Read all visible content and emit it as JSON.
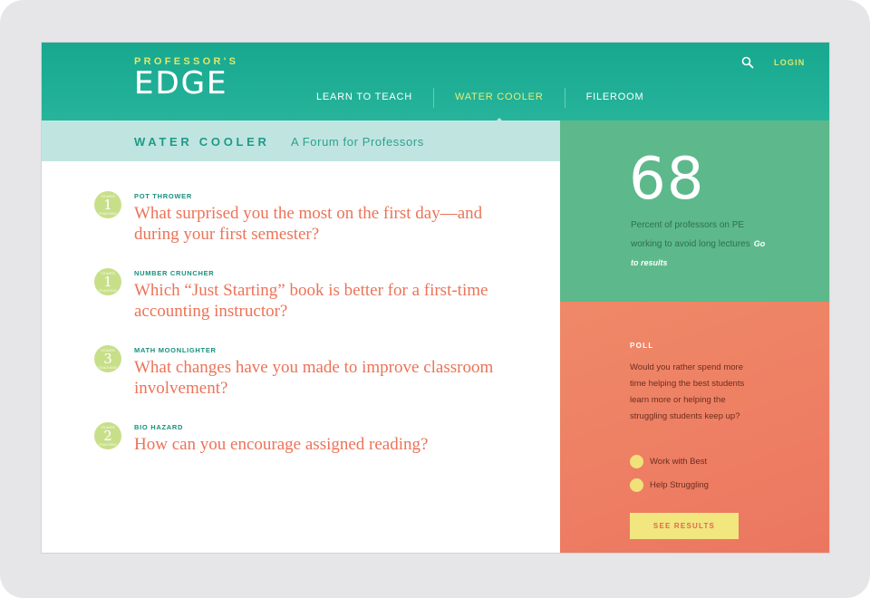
{
  "logo": {
    "top": "PROFESSOR'S",
    "main": "EDGE"
  },
  "header": {
    "login": "LOGIN"
  },
  "nav": [
    {
      "label": "LEARN TO TEACH"
    },
    {
      "label": "WATER COOLER",
      "active": true
    },
    {
      "label": "FILEROOM"
    }
  ],
  "subheader": {
    "title": "WATER COOLER",
    "tagline": "A Forum for Professors"
  },
  "questions": [
    {
      "author": "POT THROWER",
      "years": "1",
      "text": "What surprised you the most on the first day—and during your first semester?"
    },
    {
      "author": "NUMBER CRUNCHER",
      "years": "1",
      "text": "Which “Just Starting” book is better for a first-time accounting instructor?"
    },
    {
      "author": "MATH MOONLIGHTER",
      "years": "3",
      "text": "What changes have you made to improve classroom involvement?"
    },
    {
      "author": "BIO HAZARD",
      "years": "2",
      "text": "How can you encourage assigned reading?"
    }
  ],
  "badge": {
    "top_label": "YEARS",
    "bottom_label": "TEACHING"
  },
  "stat": {
    "number": "68",
    "description": "Percent of professors on PE working to avoid long lectures",
    "link": "Go to results"
  },
  "poll": {
    "label": "POLL",
    "question": "Would you rather spend more time helping the best students learn more or helping the struggling students keep up?",
    "options": [
      "Work with Best",
      "Help Struggling"
    ],
    "button": "SEE RESULTS"
  },
  "colors": {
    "header": "#1aab92",
    "accent_yellow": "#dfe86b",
    "question_text": "#ec7358",
    "stat_bg": "#5db98b",
    "poll_bg": "#ee7e64",
    "badge": "#c8df8a"
  }
}
